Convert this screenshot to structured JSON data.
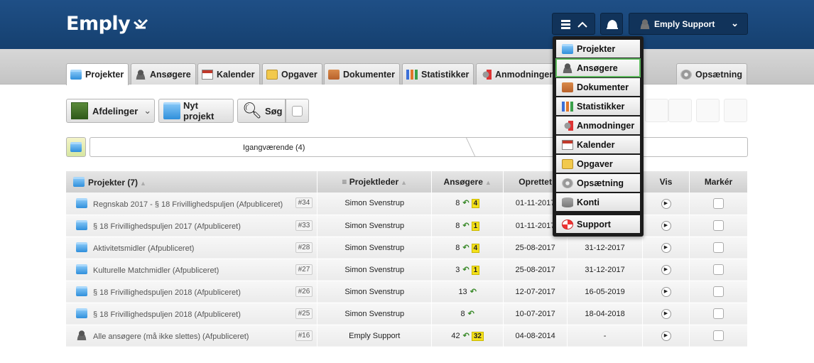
{
  "header": {
    "logo": "Emply",
    "user_name": "Emply Support"
  },
  "tabs": [
    {
      "label": "Projekter",
      "icon": "folder-icon"
    },
    {
      "label": "Ansøgere",
      "icon": "person-icon"
    },
    {
      "label": "Kalender",
      "icon": "calendar-icon"
    },
    {
      "label": "Opgaver",
      "icon": "checklist-icon"
    },
    {
      "label": "Dokumenter",
      "icon": "document-icon"
    },
    {
      "label": "Statistikker",
      "icon": "bar-chart-icon"
    },
    {
      "label": "Anmodninger",
      "icon": "request-icon"
    },
    {
      "label": "Opsætning",
      "icon": "gear-icon"
    }
  ],
  "toolbar": {
    "departments_label": "Afdelinger",
    "new_project_label": "Nyt projekt",
    "search_label": "Søg"
  },
  "breadcrumb": {
    "status_label": "Igangværende (4)"
  },
  "table": {
    "headers": {
      "project": "Projekter (7)",
      "manager": "Projektleder",
      "applicants": "Ansøgere",
      "created": "Oprettet",
      "deadline": "",
      "view": "Vis",
      "select": "Markér"
    },
    "rows": [
      {
        "name": "Regnskab 2017 - § 18 Frivillighedspuljen (Afpubliceret)",
        "id": "#34",
        "manager": "Simon Svenstrup",
        "applicants": "8",
        "badge": "4",
        "created": "01-11-2017",
        "deadline": "",
        "icon": "folder"
      },
      {
        "name": "§ 18 Frivillighedspuljen 2017 (Afpubliceret)",
        "id": "#33",
        "manager": "Simon Svenstrup",
        "applicants": "8",
        "badge": "1",
        "created": "01-11-2017",
        "deadline": "",
        "icon": "folder"
      },
      {
        "name": "Aktivitetsmidler (Afpubliceret)",
        "id": "#28",
        "manager": "Simon Svenstrup",
        "applicants": "8",
        "badge": "4",
        "created": "25-08-2017",
        "deadline": "31-12-2017",
        "icon": "folder"
      },
      {
        "name": "Kulturelle Matchmidler (Afpubliceret)",
        "id": "#27",
        "manager": "Simon Svenstrup",
        "applicants": "3",
        "badge": "1",
        "created": "25-08-2017",
        "deadline": "31-12-2017",
        "icon": "folder"
      },
      {
        "name": "§ 18 Frivillighedspuljen 2018 (Afpubliceret)",
        "id": "#26",
        "manager": "Simon Svenstrup",
        "applicants": "13",
        "badge": "",
        "created": "12-07-2017",
        "deadline": "16-05-2019",
        "icon": "folder"
      },
      {
        "name": "§ 18 Frivillighedspuljen 2018 (Afpubliceret)",
        "id": "#25",
        "manager": "Simon Svenstrup",
        "applicants": "8",
        "badge": "",
        "created": "10-07-2017",
        "deadline": "18-04-2018",
        "icon": "folder"
      },
      {
        "name": "Alle ansøgere (må ikke slettes) (Afpubliceret)",
        "id": "#16",
        "manager": "Emply Support",
        "applicants": "42",
        "badge": "32",
        "created": "04-08-2014",
        "deadline": "-",
        "icon": "person"
      }
    ]
  },
  "dropdown_menu": {
    "items": [
      {
        "label": "Projekter",
        "icon": "folder-icon"
      },
      {
        "label": "Ansøgere",
        "icon": "person-icon"
      },
      {
        "label": "Dokumenter",
        "icon": "document-icon"
      },
      {
        "label": "Statistikker",
        "icon": "bar-chart-icon"
      },
      {
        "label": "Anmodninger",
        "icon": "request-icon"
      },
      {
        "label": "Kalender",
        "icon": "calendar-icon"
      },
      {
        "label": "Opgaver",
        "icon": "checklist-icon"
      },
      {
        "label": "Opsætning",
        "icon": "gear-icon"
      },
      {
        "label": "Konti",
        "icon": "database-icon"
      },
      {
        "label": "Support",
        "icon": "lifebuoy-icon"
      }
    ],
    "highlighted": "Ansøgere"
  },
  "colors": {
    "header_bg": "#1a4a80",
    "highlight": "#5cb85c",
    "badge": "#f5e11a"
  }
}
